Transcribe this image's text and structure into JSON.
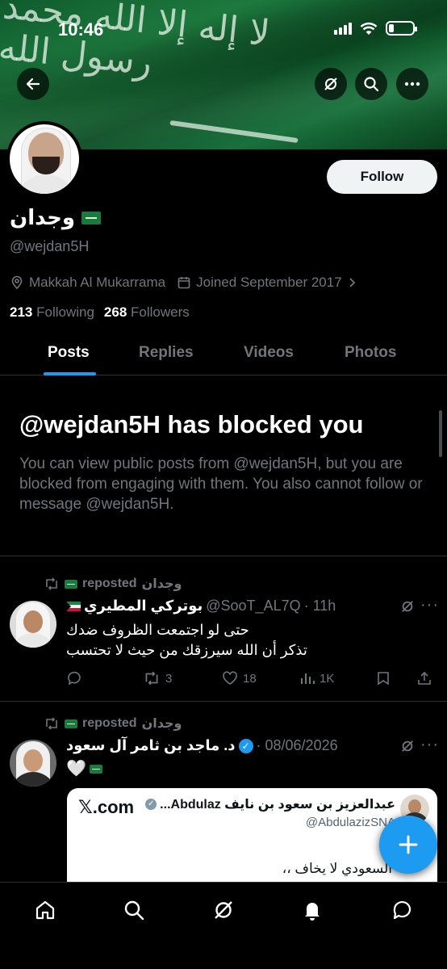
{
  "status_bar": {
    "time": "10:46"
  },
  "profile": {
    "display_name": "وجدان",
    "handle": "@wejdan5H",
    "location": "Makkah Al Mukarrama",
    "joined": "Joined September 2017",
    "following_count": "213",
    "following_label": "Following",
    "followers_count": "268",
    "followers_label": "Followers",
    "follow_button": "Follow"
  },
  "tabs": [
    {
      "label": "Posts",
      "active": true
    },
    {
      "label": "Replies",
      "active": false
    },
    {
      "label": "Videos",
      "active": false
    },
    {
      "label": "Photos",
      "active": false
    }
  ],
  "blocked": {
    "title": "@wejdan5H has blocked you",
    "message": "You can view public posts from @wejdan5H, but you are blocked from engaging with them. You also cannot follow or message @wejdan5H."
  },
  "posts": [
    {
      "repost_label": "reposted",
      "reposter_name": "وجدان",
      "author_name": "بوتركي المطيري",
      "author_handle": "@SooT_AL7Q",
      "time": "· 11h",
      "lines": [
        "حتى لو اجتمعت الظروف ضدك",
        "تذكر أن الله سيرزقك من حيث لا تحتسب"
      ],
      "stats": {
        "replies": "",
        "reposts": "3",
        "likes": "18",
        "views": "1K"
      }
    },
    {
      "repost_label": "reposted",
      "reposter_name": "وجدان",
      "author_name": "د. ماجد بن ثامر آل سعود",
      "time": "· 08/06/2026",
      "heart": "🤍",
      "quote": {
        "name": "عبدالعزيز بن سعود بن نايف Abdulaz...",
        "handle": "@AbdulazizSNA",
        "site": "𝕏.com",
        "text": "السعودي لا يخاف ،،"
      }
    }
  ],
  "icons": {
    "back": "arrow-left-icon",
    "grok": "grok-icon",
    "search": "search-icon",
    "more": "more-icon",
    "compose": "plus-icon",
    "home": "home-icon",
    "explore": "search-icon",
    "grok_nav": "grok-icon",
    "notifications": "bell-icon",
    "messages": "chat-icon"
  },
  "colors": {
    "accent": "#1d9bf0",
    "background": "#000000",
    "secondary_text": "#71767b"
  }
}
